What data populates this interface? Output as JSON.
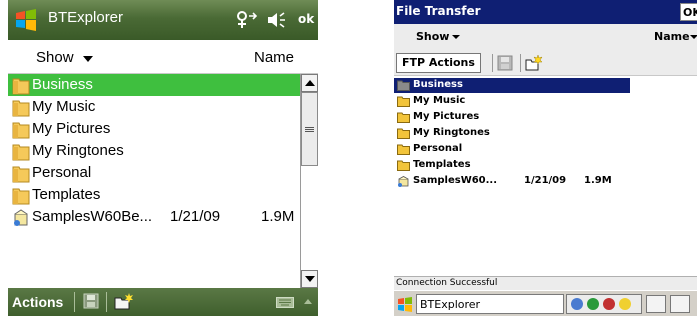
{
  "left_device": {
    "title_bar": {
      "app_title": "BTExplorer",
      "ok_label": "ok",
      "icons": [
        "windows-start-icon",
        "bluetooth-connection-icon",
        "volume-icon"
      ]
    },
    "header": {
      "show_label": "Show",
      "name_label": "Name"
    },
    "files": [
      {
        "name": "Business",
        "type": "folder",
        "selected": true
      },
      {
        "name": "My Music",
        "type": "folder"
      },
      {
        "name": "My Pictures",
        "type": "folder"
      },
      {
        "name": "My Ringtones",
        "type": "folder"
      },
      {
        "name": "Personal",
        "type": "folder"
      },
      {
        "name": "Templates",
        "type": "folder"
      },
      {
        "name": "SamplesW60Be...",
        "type": "file",
        "date": "1/21/09",
        "size": "1.9M"
      }
    ],
    "bottom_bar": {
      "actions_label": "Actions",
      "icons": [
        "save-icon",
        "new-folder-icon",
        "keyboard-icon"
      ]
    },
    "colors": {
      "title_bar": "#4a6a35",
      "selection": "#3fbf3f",
      "bottom_bar": "#3f5f2d"
    }
  },
  "right_device": {
    "title_bar": {
      "title": "File Transfer",
      "ok_label": "OK"
    },
    "header": {
      "show_label": "Show",
      "name_label": "Name"
    },
    "toolbar": {
      "ftp_actions_label": "FTP Actions",
      "icons": [
        "save-icon",
        "new-folder-icon"
      ]
    },
    "files": [
      {
        "name": "Business",
        "type": "folder",
        "selected": true
      },
      {
        "name": "My Music",
        "type": "folder"
      },
      {
        "name": "My Pictures",
        "type": "folder"
      },
      {
        "name": "My Ringtones",
        "type": "folder"
      },
      {
        "name": "Personal",
        "type": "folder"
      },
      {
        "name": "Templates",
        "type": "folder"
      },
      {
        "name": "SamplesW60...",
        "type": "file",
        "date": "1/21/09",
        "size": "1.9M"
      }
    ],
    "status_text": "Connection Successful",
    "taskbar": {
      "task_label": "BTExplorer",
      "icons": [
        "start-icon",
        "bluetooth-icon",
        "network-icon",
        "sun-icon",
        "keyboard-icon",
        "sip-icon"
      ]
    },
    "colors": {
      "title_bar": "#0f1f73",
      "selection": "#0f1f73",
      "folder": "#f2c43a"
    }
  }
}
